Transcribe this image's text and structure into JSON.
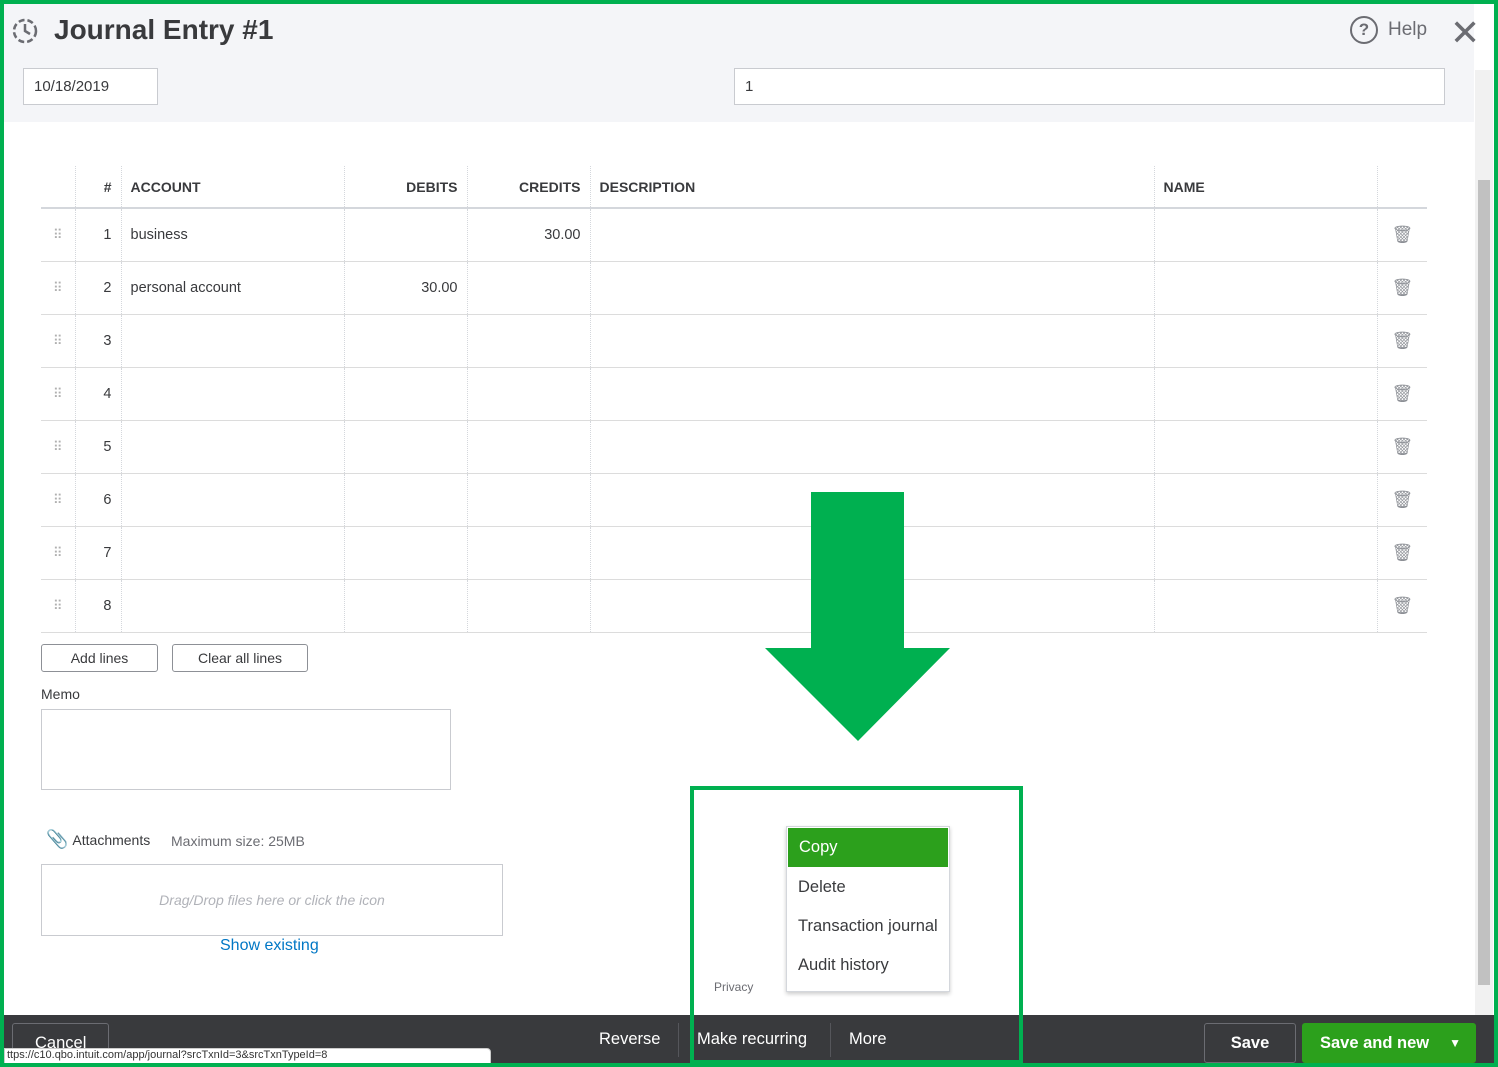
{
  "header": {
    "title": "Journal Entry #1",
    "help_label": "Help",
    "date_value": "10/18/2019",
    "journal_no_value": "1"
  },
  "table": {
    "columns": [
      "#",
      "ACCOUNT",
      "DEBITS",
      "CREDITS",
      "DESCRIPTION",
      "NAME"
    ],
    "rows": [
      {
        "n": "1",
        "account": "business",
        "debit": "",
        "credit": "30.00"
      },
      {
        "n": "2",
        "account": "personal account",
        "debit": "30.00",
        "credit": ""
      },
      {
        "n": "3",
        "account": "",
        "debit": "",
        "credit": ""
      },
      {
        "n": "4",
        "account": "",
        "debit": "",
        "credit": ""
      },
      {
        "n": "5",
        "account": "",
        "debit": "",
        "credit": ""
      },
      {
        "n": "6",
        "account": "",
        "debit": "",
        "credit": ""
      },
      {
        "n": "7",
        "account": "",
        "debit": "",
        "credit": ""
      },
      {
        "n": "8",
        "account": "",
        "debit": "",
        "credit": ""
      }
    ]
  },
  "actions": {
    "add_lines": "Add lines",
    "clear_lines": "Clear all lines"
  },
  "memo": {
    "label": "Memo"
  },
  "attachments": {
    "label": "Attachments",
    "max_size": "Maximum size: 25MB",
    "drop_hint": "Drag/Drop files here or click the icon",
    "show_existing": "Show existing"
  },
  "privacy": "Privacy",
  "more_menu": {
    "items": [
      "Copy",
      "Delete",
      "Transaction journal",
      "Audit history"
    ]
  },
  "footer": {
    "cancel": "Cancel",
    "reverse": "Reverse",
    "make_recurring": "Make recurring",
    "more": "More",
    "save": "Save",
    "save_and_new": "Save and new"
  },
  "status_url": "ttps://c10.qbo.intuit.com/app/journal?srcTxnId=3&srcTxnTypeId=8",
  "colors": {
    "accent": "#2ca01c",
    "annotation": "#00b050",
    "footer": "#393a3d"
  }
}
